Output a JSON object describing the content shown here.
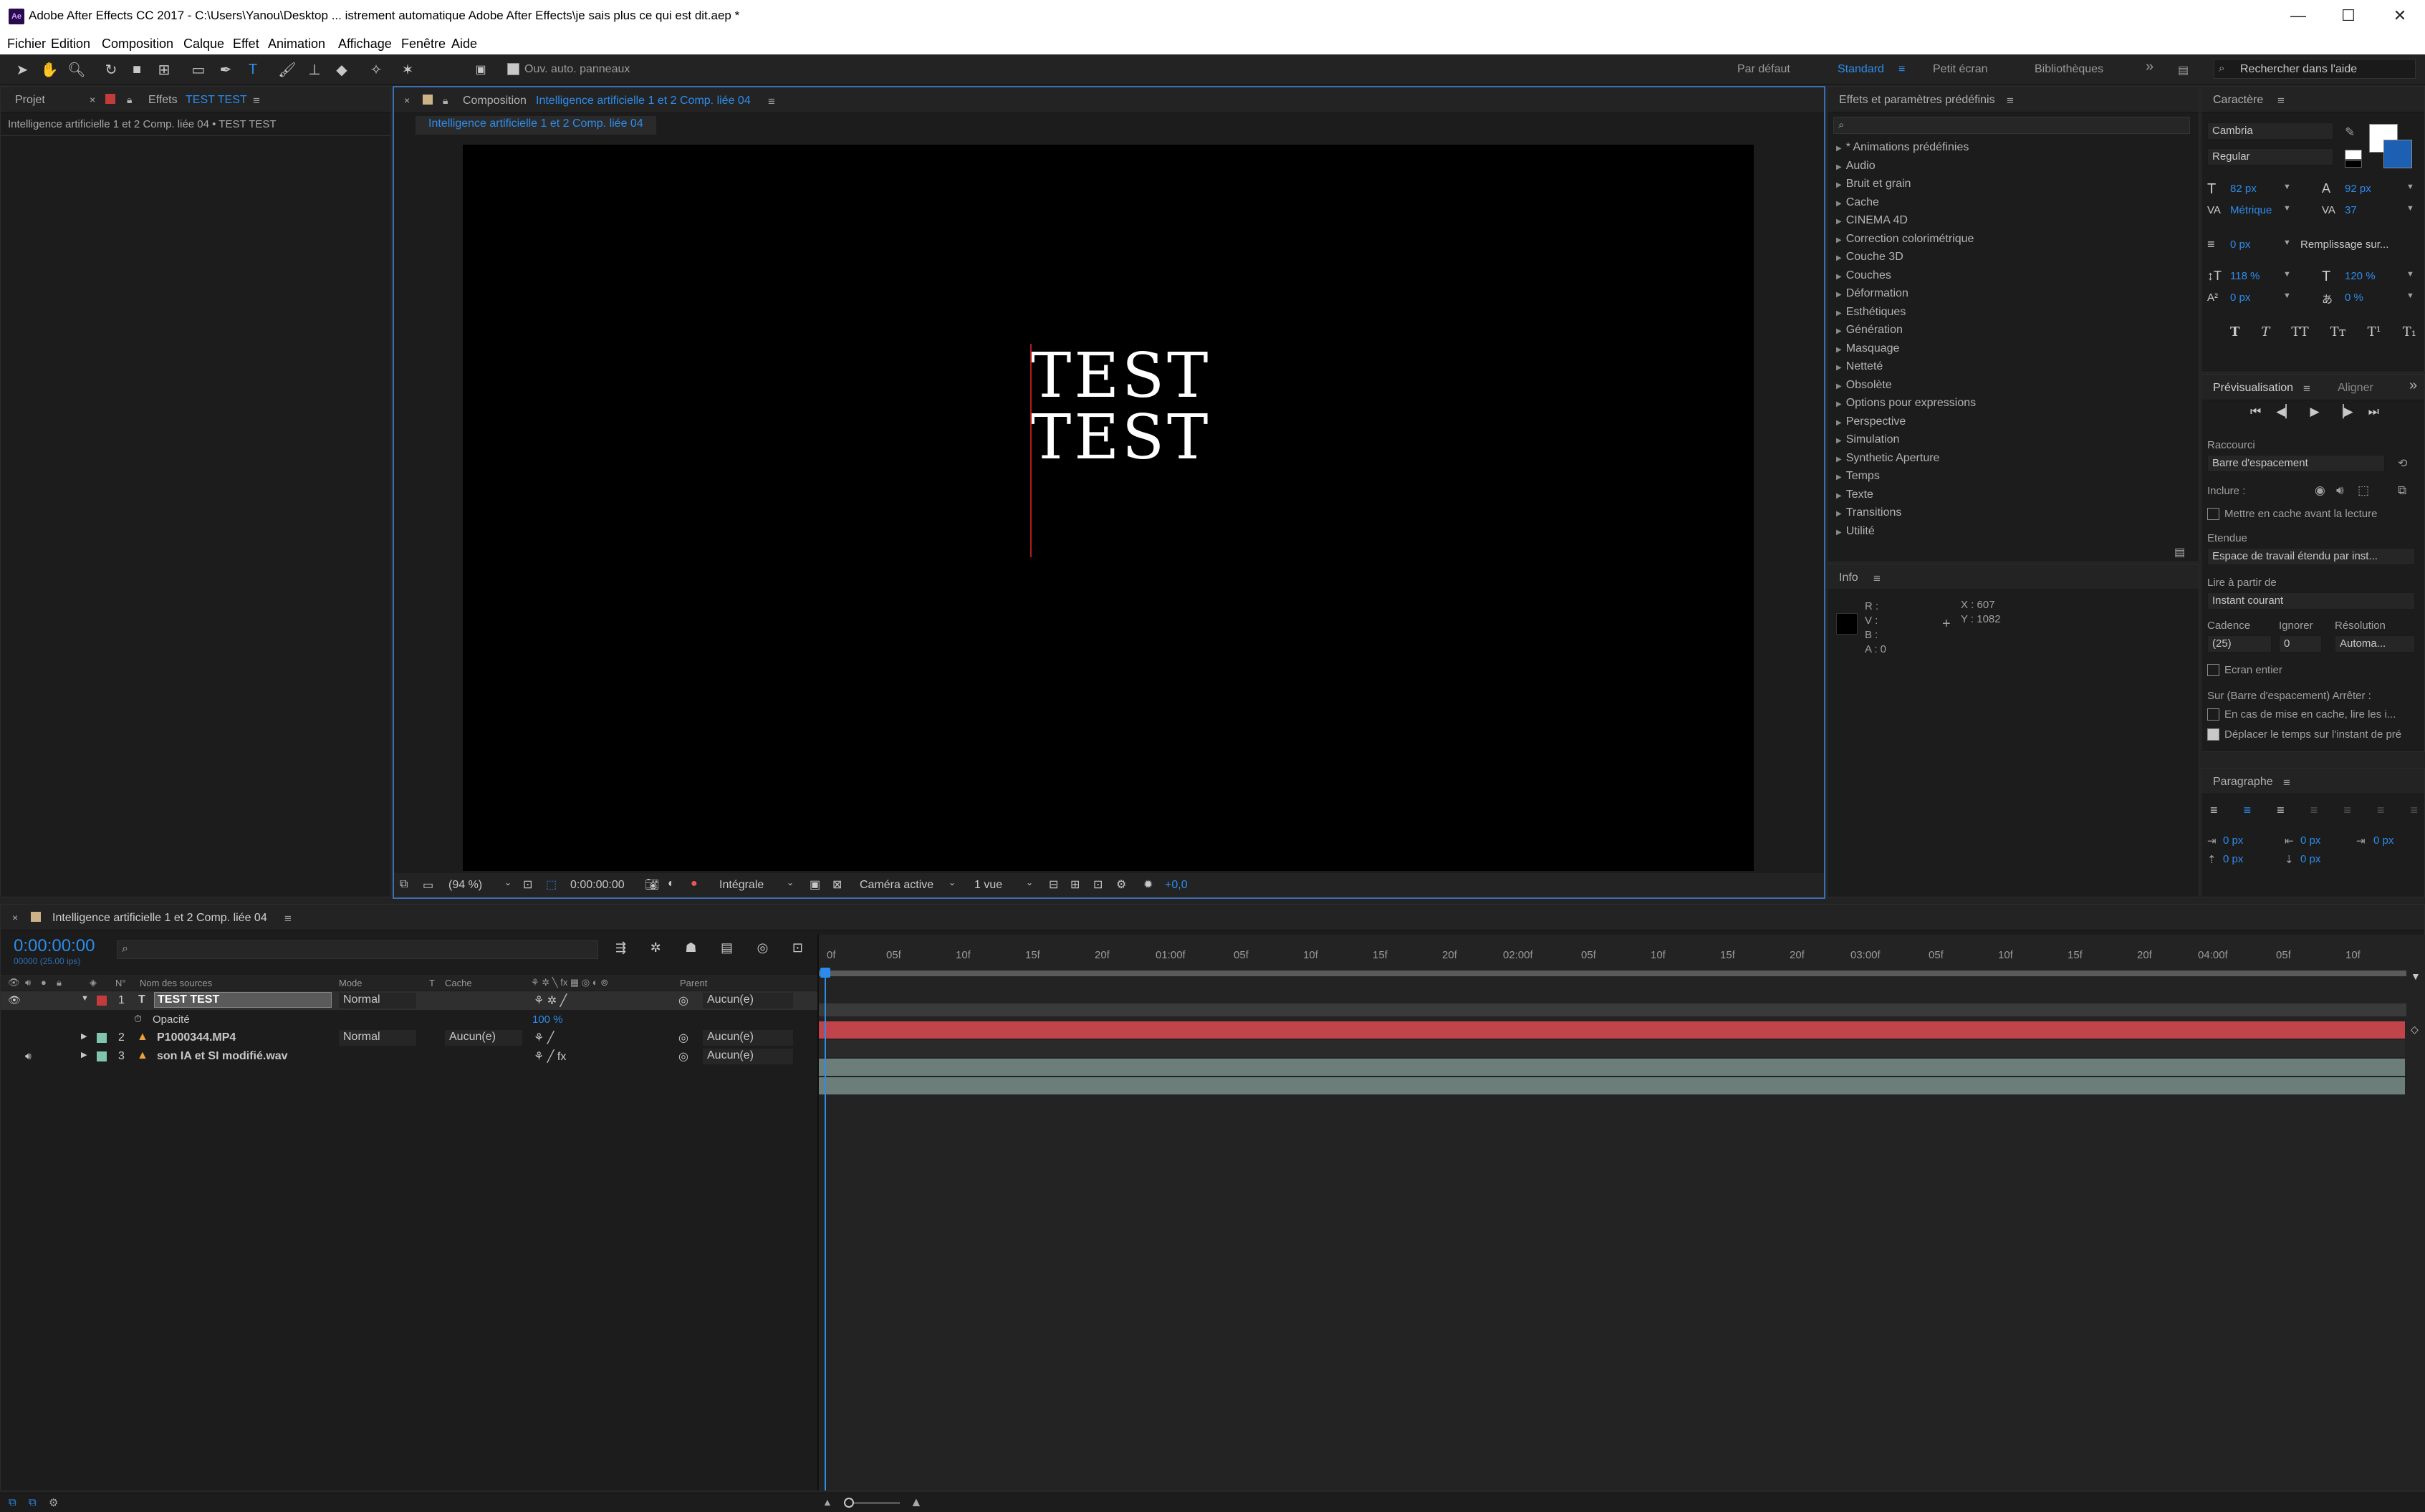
{
  "app": {
    "icon_label": "Ae",
    "title": "Adobe After Effects CC 2017 - C:\\Users\\Yanou\\Desktop ... istrement automatique Adobe After Effects\\je sais plus ce qui est dit.aep *"
  },
  "menu": [
    "Fichier",
    "Edition",
    "Composition",
    "Calque",
    "Effet",
    "Animation",
    "Affichage",
    "Fenêtre",
    "Aide"
  ],
  "toolbar": {
    "auto_open_panels": "Ouv. auto. panneaux",
    "workspaces": [
      "Par défaut",
      "Standard",
      "Petit écran",
      "Bibliothèques"
    ],
    "active_workspace": "Standard",
    "search_placeholder": "Rechercher dans l'aide"
  },
  "project_panel": {
    "tab_project": "Projet",
    "tab_effects": "Effets",
    "effects_target": "TEST TEST",
    "breadcrumb": "Intelligence artificielle 1 et 2 Comp. liée 04 • TEST TEST"
  },
  "composition": {
    "tab_label": "Composition",
    "comp_name": "Intelligence artificielle 1 et 2 Comp. liée 04",
    "subtab": "Intelligence artificielle 1 et 2 Comp. liée 04",
    "text_line1": "TEST",
    "text_line2": "TEST",
    "zoom": "(94 %)",
    "timecode": "0:00:00:00",
    "resolution": "Intégrale",
    "camera": "Caméra active",
    "views": "1 vue",
    "exposure": "+0,0"
  },
  "effects_panel": {
    "title": "Effets et paramètres prédéfinis",
    "items": [
      "* Animations prédéfinies",
      "Audio",
      "Bruit et grain",
      "Cache",
      "CINEMA 4D",
      "Correction colorimétrique",
      "Couche 3D",
      "Couches",
      "Déformation",
      "Esthétiques",
      "Génération",
      "Masquage",
      "Netteté",
      "Obsolète",
      "Options pour expressions",
      "Perspective",
      "Simulation",
      "Synthetic Aperture",
      "Temps",
      "Texte",
      "Transitions",
      "Utilité"
    ]
  },
  "info_panel": {
    "title": "Info",
    "r": "R :",
    "v": "V :",
    "b": "B :",
    "a": "A : 0",
    "x": "X : 607",
    "y": "Y : 1082"
  },
  "character_panel": {
    "title": "Caractère",
    "font": "Cambria",
    "style": "Regular",
    "size": "82 px",
    "leading": "92 px",
    "kerning": "Métrique",
    "tracking": "37",
    "stroke": "0 px",
    "stroke_mode": "Remplissage sur...",
    "vscale": "118 %",
    "hscale": "120 %",
    "baseline": "0 px",
    "tsume": "0 %",
    "style_buttons": [
      "T",
      "T",
      "TT",
      "Tт",
      "T¹",
      "T₁"
    ]
  },
  "preview_panel": {
    "tab_preview": "Prévisualisation",
    "tab_align": "Aligner",
    "shortcut_label": "Raccourci",
    "shortcut_value": "Barre d'espacement",
    "include_label": "Inclure :",
    "cache_before": "Mettre en cache avant la lecture",
    "range_label": "Etendue",
    "range_value": "Espace de travail étendu par inst...",
    "play_from_label": "Lire à partir de",
    "play_from_value": "Instant courant",
    "framerate_label": "Cadence",
    "skip_label": "Ignorer",
    "resolution_label": "Résolution",
    "framerate_value": "(25)",
    "skip_value": "0",
    "resolution_value": "Automa...",
    "fullscreen": "Ecran entier",
    "on_stop_label": "Sur (Barre d'espacement) Arrêter :",
    "opt1": "En cas de mise en cache, lire les i...",
    "opt2": "Déplacer le temps sur l'instant de pré"
  },
  "paragraph_panel": {
    "title": "Paragraphe",
    "indent_left": "0 px",
    "indent_right": "0 px",
    "indent_first": "0 px",
    "space_before": "0 px",
    "space_after": "0 px"
  },
  "timeline": {
    "tab_label": "Intelligence artificielle 1 et 2 Comp. liée 04",
    "timecode": "0:00:00:00",
    "sub_timecode": "00000 (25.00 ips)",
    "col_num": "N°",
    "col_source": "Nom des sources",
    "col_mode": "Mode",
    "col_t": "T",
    "col_cache": "Cache",
    "col_parent": "Parent",
    "layers": [
      {
        "num": "1",
        "name": "TEST TEST",
        "mode": "Normal",
        "cache": "",
        "parent": "Aucun(e)",
        "type": "T",
        "label_color": "#c33b3b"
      },
      {
        "num": "2",
        "name": "P1000344.MP4",
        "mode": "Normal",
        "cache": "Aucun(e)",
        "parent": "Aucun(e)",
        "type": "video",
        "label_color": "#7fc5b0"
      },
      {
        "num": "3",
        "name": "son IA et SI modifié.wav",
        "mode": "",
        "cache": "",
        "parent": "Aucun(e)",
        "type": "audio",
        "label_color": "#7fc5b0"
      }
    ],
    "property_name": "Opacité",
    "property_value": "100 %",
    "ruler": [
      "0f",
      "05f",
      "10f",
      "15f",
      "20f",
      "01:00f",
      "05f",
      "10f",
      "15f",
      "20f",
      "02:00f",
      "05f",
      "10f",
      "15f",
      "20f",
      "03:00f",
      "05f",
      "10f",
      "15f",
      "20f",
      "04:00f",
      "05f",
      "10f"
    ]
  }
}
